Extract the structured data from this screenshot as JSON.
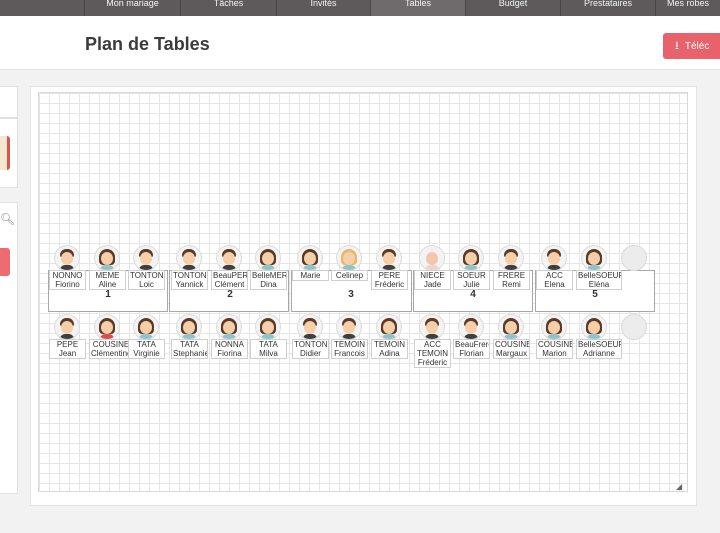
{
  "nav": {
    "tabs": [
      {
        "label": "Mon mariage"
      },
      {
        "label": "Tâches"
      },
      {
        "label": "Invités"
      },
      {
        "label": "Tables"
      },
      {
        "label": "Budget"
      },
      {
        "label": "Prestataires"
      },
      {
        "label": "Mes robes"
      }
    ],
    "active_index": 3
  },
  "header": {
    "title": "Plan de Tables",
    "download_label": "Téléc",
    "download_icon": "download-icon"
  },
  "tables": [
    {
      "number": "1"
    },
    {
      "number": "2"
    },
    {
      "number": "3"
    },
    {
      "number": "4"
    },
    {
      "number": "5"
    }
  ],
  "guests_top": [
    {
      "role": "NONNO",
      "name": "Fiorino",
      "avatar": "m"
    },
    {
      "role": "MEME",
      "name": "Aline",
      "avatar": "f"
    },
    {
      "role": "TONTON",
      "name": "Loic",
      "avatar": "m"
    },
    {
      "role": "TONTON",
      "name": "Yannick",
      "avatar": "m"
    },
    {
      "role": "BeauPERE",
      "name": "Clément",
      "avatar": "m"
    },
    {
      "role": "BelleMERE",
      "name": "Dina",
      "avatar": "f"
    },
    {
      "role": "",
      "name": "Marie",
      "avatar": "f"
    },
    {
      "role": "",
      "name": "Celinep",
      "avatar": "blonde"
    },
    {
      "role": "PERE",
      "name": "Fréderic",
      "avatar": "m"
    },
    {
      "role": "NIECE",
      "name": "Jade",
      "avatar": "baby"
    },
    {
      "role": "SOEUR",
      "name": "Julie",
      "avatar": "f"
    },
    {
      "role": "FRERE",
      "name": "Remi",
      "avatar": "m"
    },
    {
      "role": "ACC",
      "name": "Elena",
      "avatar": "m"
    },
    {
      "role": "BelleSOEUR",
      "name": "Eléna",
      "avatar": "f"
    }
  ],
  "guests_bottom": [
    {
      "role": "PEPE",
      "name": "Jean",
      "avatar": "m"
    },
    {
      "role": "COUSINE",
      "name": "Clémentine",
      "avatar": "red"
    },
    {
      "role": "TATA",
      "name": "Virginie",
      "avatar": "f"
    },
    {
      "role": "TATA",
      "name": "Stephanie",
      "avatar": "f"
    },
    {
      "role": "NONNA",
      "name": "Fiorina",
      "avatar": "f"
    },
    {
      "role": "TATA",
      "name": "Milva",
      "avatar": "f"
    },
    {
      "role": "TONTON",
      "name": "Didier",
      "avatar": "m"
    },
    {
      "role": "TEMOIN",
      "name": "Francois",
      "avatar": "m"
    },
    {
      "role": "TEMOIN",
      "name": "Adina",
      "avatar": "f"
    },
    {
      "role": "ACC TEMOIN",
      "name": "Fréderic",
      "avatar": "m"
    },
    {
      "role": "BeauFrere",
      "name": "Florian",
      "avatar": "m"
    },
    {
      "role": "COUSINE",
      "name": "Margaux",
      "avatar": "f"
    },
    {
      "role": "COUSINE",
      "name": "Marion",
      "avatar": "f"
    },
    {
      "role": "BelleSOEUR",
      "name": "Adrianne",
      "avatar": "f"
    }
  ],
  "colors": {
    "accent": "#e9616a",
    "nav_bg": "#5e5a5c"
  }
}
